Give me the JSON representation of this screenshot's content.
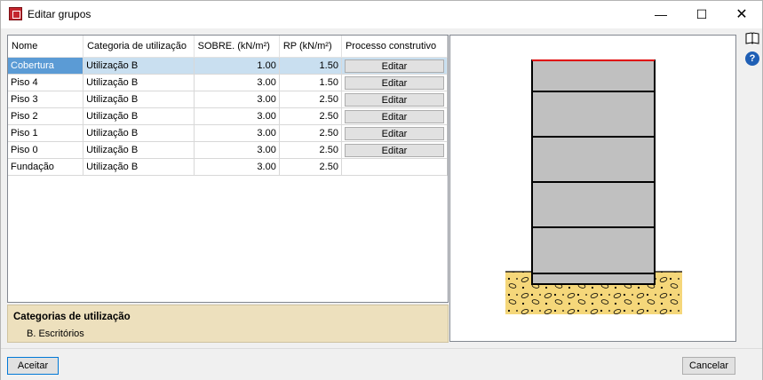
{
  "window": {
    "title": "Editar grupos"
  },
  "table": {
    "headers": [
      "Nome",
      "Categoria de utilização",
      "SOBRE. (kN/m²)",
      "RP (kN/m²)",
      "Processo construtivo"
    ],
    "rows": [
      {
        "name": "Cobertura",
        "category": "Utilização B",
        "sobre": "1.00",
        "rp": "1.50",
        "action": "Editar"
      },
      {
        "name": "Piso 4",
        "category": "Utilização B",
        "sobre": "3.00",
        "rp": "1.50",
        "action": "Editar"
      },
      {
        "name": "Piso 3",
        "category": "Utilização B",
        "sobre": "3.00",
        "rp": "2.50",
        "action": "Editar"
      },
      {
        "name": "Piso 2",
        "category": "Utilização B",
        "sobre": "3.00",
        "rp": "2.50",
        "action": "Editar"
      },
      {
        "name": "Piso 1",
        "category": "Utilização B",
        "sobre": "3.00",
        "rp": "2.50",
        "action": "Editar"
      },
      {
        "name": "Piso 0",
        "category": "Utilização B",
        "sobre": "3.00",
        "rp": "2.50",
        "action": "Editar"
      },
      {
        "name": "Fundação",
        "category": "Utilização B",
        "sobre": "3.00",
        "rp": "2.50",
        "action": ""
      }
    ]
  },
  "info": {
    "title": "Categorias de utilização",
    "item": "B. Escritórios"
  },
  "buttons": {
    "ok": "Aceitar",
    "cancel": "Cancelar"
  },
  "colors": {
    "selection": "#5b9bd5",
    "info_bg": "#ede0bd",
    "building_fill": "#c0c0c0",
    "roof_line": "#e00000",
    "soil_fill": "#f5d77a"
  }
}
